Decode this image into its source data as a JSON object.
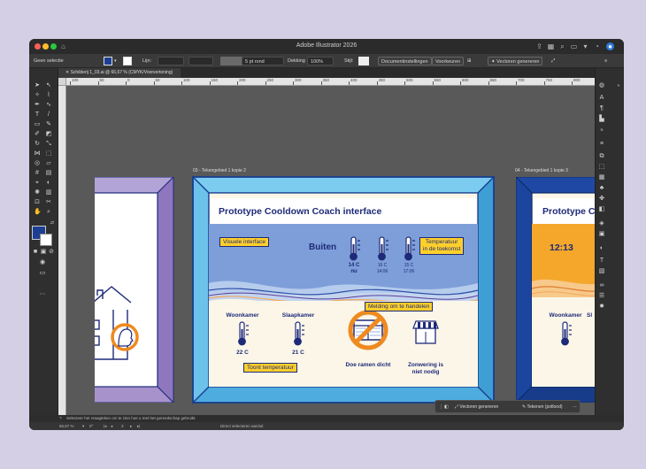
{
  "window": {
    "title": "Adobe Illustrator 2026"
  },
  "control_bar": {
    "selection": "Geen selectie",
    "stroke_label": "Lijn:",
    "brush": "5 pt rond",
    "opacity_label": "Dekking",
    "opacity_value": "100%",
    "style_label": "Stijl:",
    "doc_settings": "Documentinstellingen",
    "preferences": "Voorkeuren",
    "generate_vectors": "Vectoren genereren"
  },
  "document_tab": {
    "label": "Schilderij 1_03.ai @ 66,67 % (CMYK/Voorvertoning)"
  },
  "ruler": {
    "ticks": [
      "100",
      "50",
      "0",
      "50",
      "100",
      "150",
      "200",
      "250",
      "300",
      "350",
      "400",
      "450",
      "500",
      "550",
      "600",
      "650",
      "700",
      "750",
      "800"
    ]
  },
  "artboards": {
    "center_label": "03 - Tekengebied 1 kopie 2",
    "right_label": "04 - Tekengebied 1 kopie 3"
  },
  "slide": {
    "title": "Prototype Cooldown Coach interface",
    "visual_interface": "Visuele interface",
    "outside": "Buiten",
    "future_temp_line1": "Temperatuur",
    "future_temp_line2": "in de toekomst",
    "temps": [
      {
        "value": "14 C",
        "sub": "nu"
      },
      {
        "value": "16 C",
        "sub": "14:06"
      },
      {
        "value": "15 C",
        "sub": "17:06"
      }
    ],
    "rooms": [
      {
        "name": "Woonkamer",
        "temp": "22 C"
      },
      {
        "name": "Slaapkamer",
        "temp": "21 C"
      }
    ],
    "show_temp": "Toont temperatuur",
    "notification": "Melding om te handelen",
    "close_windows": "Doe ramen dicht",
    "sunshade_line1": "Zonwering is",
    "sunshade_line2": "niet nodig"
  },
  "right_slide": {
    "title": "Prototype Cooldo",
    "time": "12:13",
    "room1": "Woonkamer",
    "room2_partial": "Sl"
  },
  "context_bar": {
    "generate_vectors": "Vectoren genereren",
    "draw_pencil": "Tekenen (potlood)"
  },
  "status": {
    "hint": "Selecteer het vraagteken om te zien hoe u met het gereedschap gebruikt.",
    "zoom": "66,67 %",
    "artboard_nr": "3",
    "tool_info": "Direct selecteren aan/uit"
  },
  "colors": {
    "frame_light": "#5bb8e6",
    "frame_dark": "#1a3f8f",
    "navy": "#1e2a78",
    "label_yellow": "#ffd02b",
    "orange": "#ee8a1f",
    "sky": "#7d9ed8",
    "cream": "#fbf6e8",
    "purple_frame": "#9b86c4"
  }
}
